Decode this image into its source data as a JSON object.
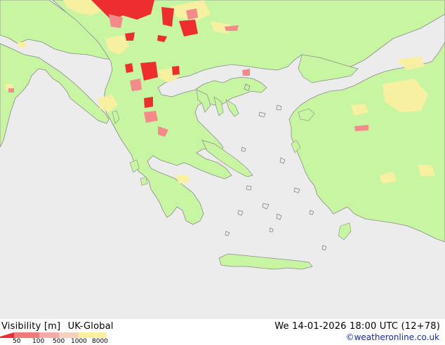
{
  "map": {
    "sea_color": "#ececec",
    "land_color": "#c8f5a2",
    "coast_color": "#8a8a8a",
    "low_visibility_color": "#ee2e2e",
    "mid_visibility_color": "#f48a8a",
    "haze_color": "#faf0a0"
  },
  "footer": {
    "product": "Visibility [m]",
    "model": "UK-Global",
    "datetime": "We 14-01-2026 18:00 UTC (12+78)",
    "credit": "©weatheronline.co.uk"
  },
  "legend": {
    "labels": [
      "50",
      "100",
      "500",
      "1000",
      "8000"
    ],
    "colors": [
      "#ee2e2e",
      "#f07a7a",
      "#f4aaaa",
      "#f8d0c0",
      "#faf0a0"
    ]
  }
}
